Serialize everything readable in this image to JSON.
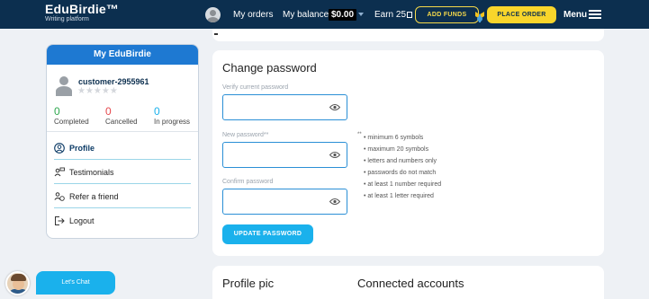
{
  "header": {
    "logo_title": "EduBirdie™",
    "logo_subtitle": "Writing platform",
    "my_orders": "My orders",
    "my_balance": "My balance",
    "balance_value": "$0.00",
    "earn": "Earn 25",
    "add_funds": "ADD FUNDS",
    "place_order": "PLACE ORDER",
    "menu": "Menu"
  },
  "sidebar": {
    "title": "My EduBirdie",
    "username": "customer-2955961",
    "rating_stars": "★★★★★",
    "stats": [
      {
        "value": "0",
        "label": "Completed",
        "color": "#2fa84f"
      },
      {
        "value": "0",
        "label": "Cancelled",
        "color": "#e5484d"
      },
      {
        "value": "0",
        "label": "In progress",
        "color": "#1ab1ec"
      }
    ],
    "items": [
      {
        "label": "Profile",
        "icon": "profile-icon",
        "active": true
      },
      {
        "label": "Testimonials",
        "icon": "testimonials-icon"
      },
      {
        "label": "Refer a friend",
        "icon": "refer-friend-icon"
      },
      {
        "label": "Logout",
        "icon": "logout-icon"
      }
    ]
  },
  "change_password": {
    "title": "Change password",
    "verify_label": "Verify current password",
    "new_label": "New password**",
    "confirm_label": "Confirm password",
    "requirements_marker": "**",
    "requirements": [
      "minimum 6 symbols",
      "maximum 20 symbols",
      "letters and numbers only",
      "passwords do not match",
      "at least 1 number required",
      "at least 1 letter required"
    ],
    "update_button": "UPDATE PASSWORD"
  },
  "bottom": {
    "profile_pic": "Profile pic",
    "connected_accounts": "Connected accounts"
  },
  "chat": {
    "label": "Let's Chat"
  },
  "colors": {
    "header_bg": "#0c2f4f",
    "accent_yellow": "#f8d52b",
    "accent_blue": "#1ab1ec",
    "sidebar_head": "#1e79d2"
  }
}
